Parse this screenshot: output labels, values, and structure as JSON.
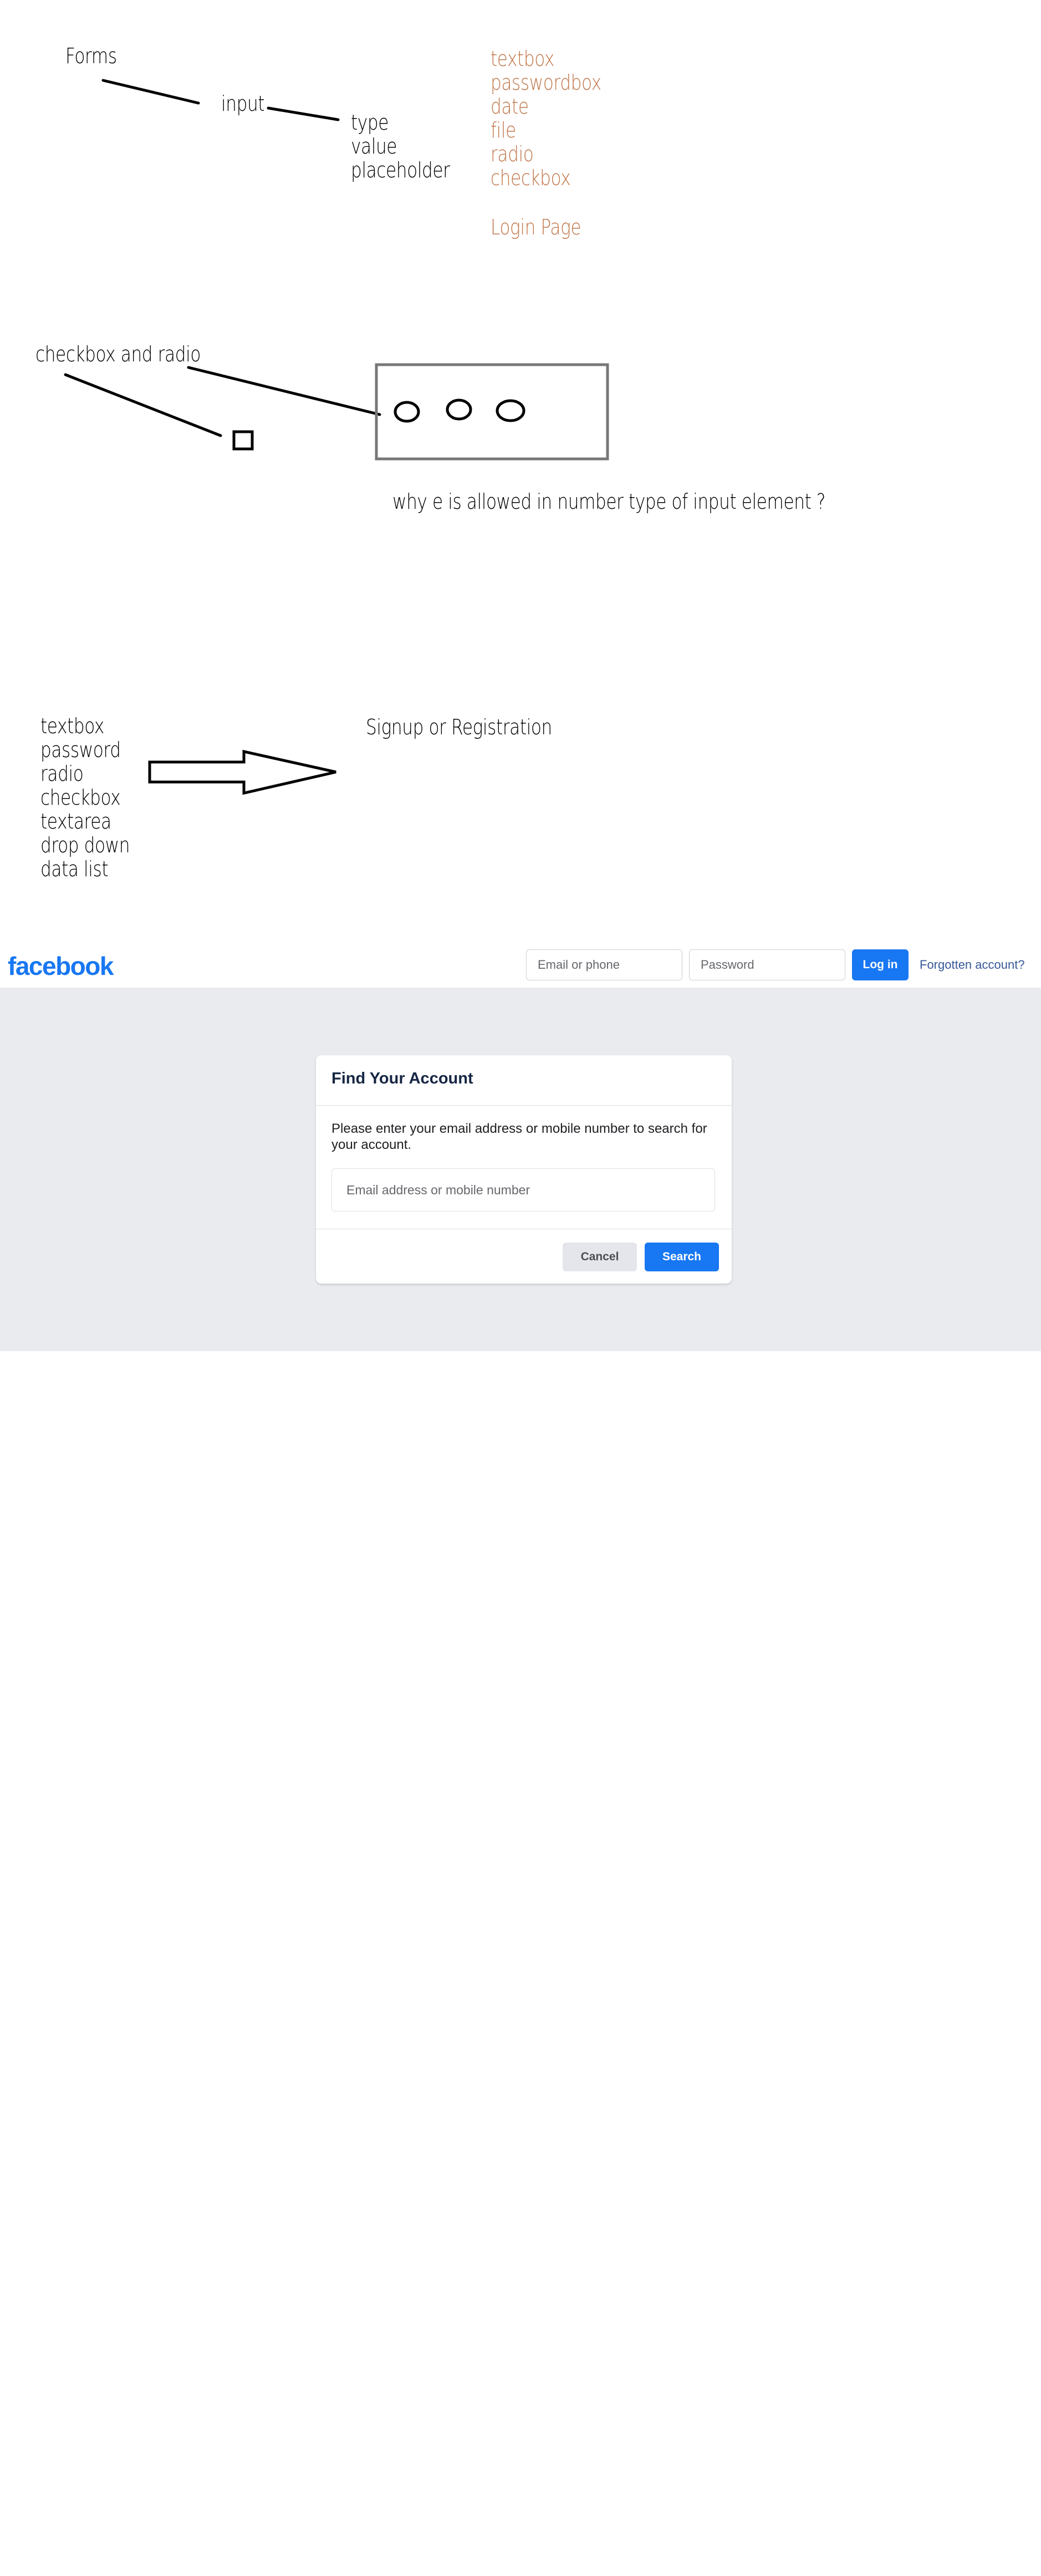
{
  "notes": {
    "forms": "Forms",
    "input": "input",
    "attributes": [
      "type",
      "value",
      "placeholder"
    ],
    "input_types": [
      "textbox",
      "passwordbox",
      "date",
      "file",
      "radio",
      "checkbox"
    ],
    "login_page": "Login Page",
    "checkbox_radio": "checkbox and radio",
    "question": "why e is allowed in number type of input element ?",
    "elements": [
      "textbox",
      "password",
      "radio",
      "checkbox",
      "textarea",
      "drop down",
      "data list"
    ],
    "signup": "Signup or Registration",
    "highlight_color": "#c0764a"
  },
  "facebook": {
    "logo": "facebook",
    "email_placeholder": "Email or phone",
    "password_placeholder": "Password",
    "login_label": "Log in",
    "forgotten_label": "Forgotten account?",
    "brand_color": "#1877f2",
    "page_bg": "#e9ebee",
    "card": {
      "title": "Find Your Account",
      "description": "Please enter your email address or mobile number to search for your account.",
      "input_placeholder": "Email address or mobile number",
      "cancel_label": "Cancel",
      "search_label": "Search"
    }
  }
}
